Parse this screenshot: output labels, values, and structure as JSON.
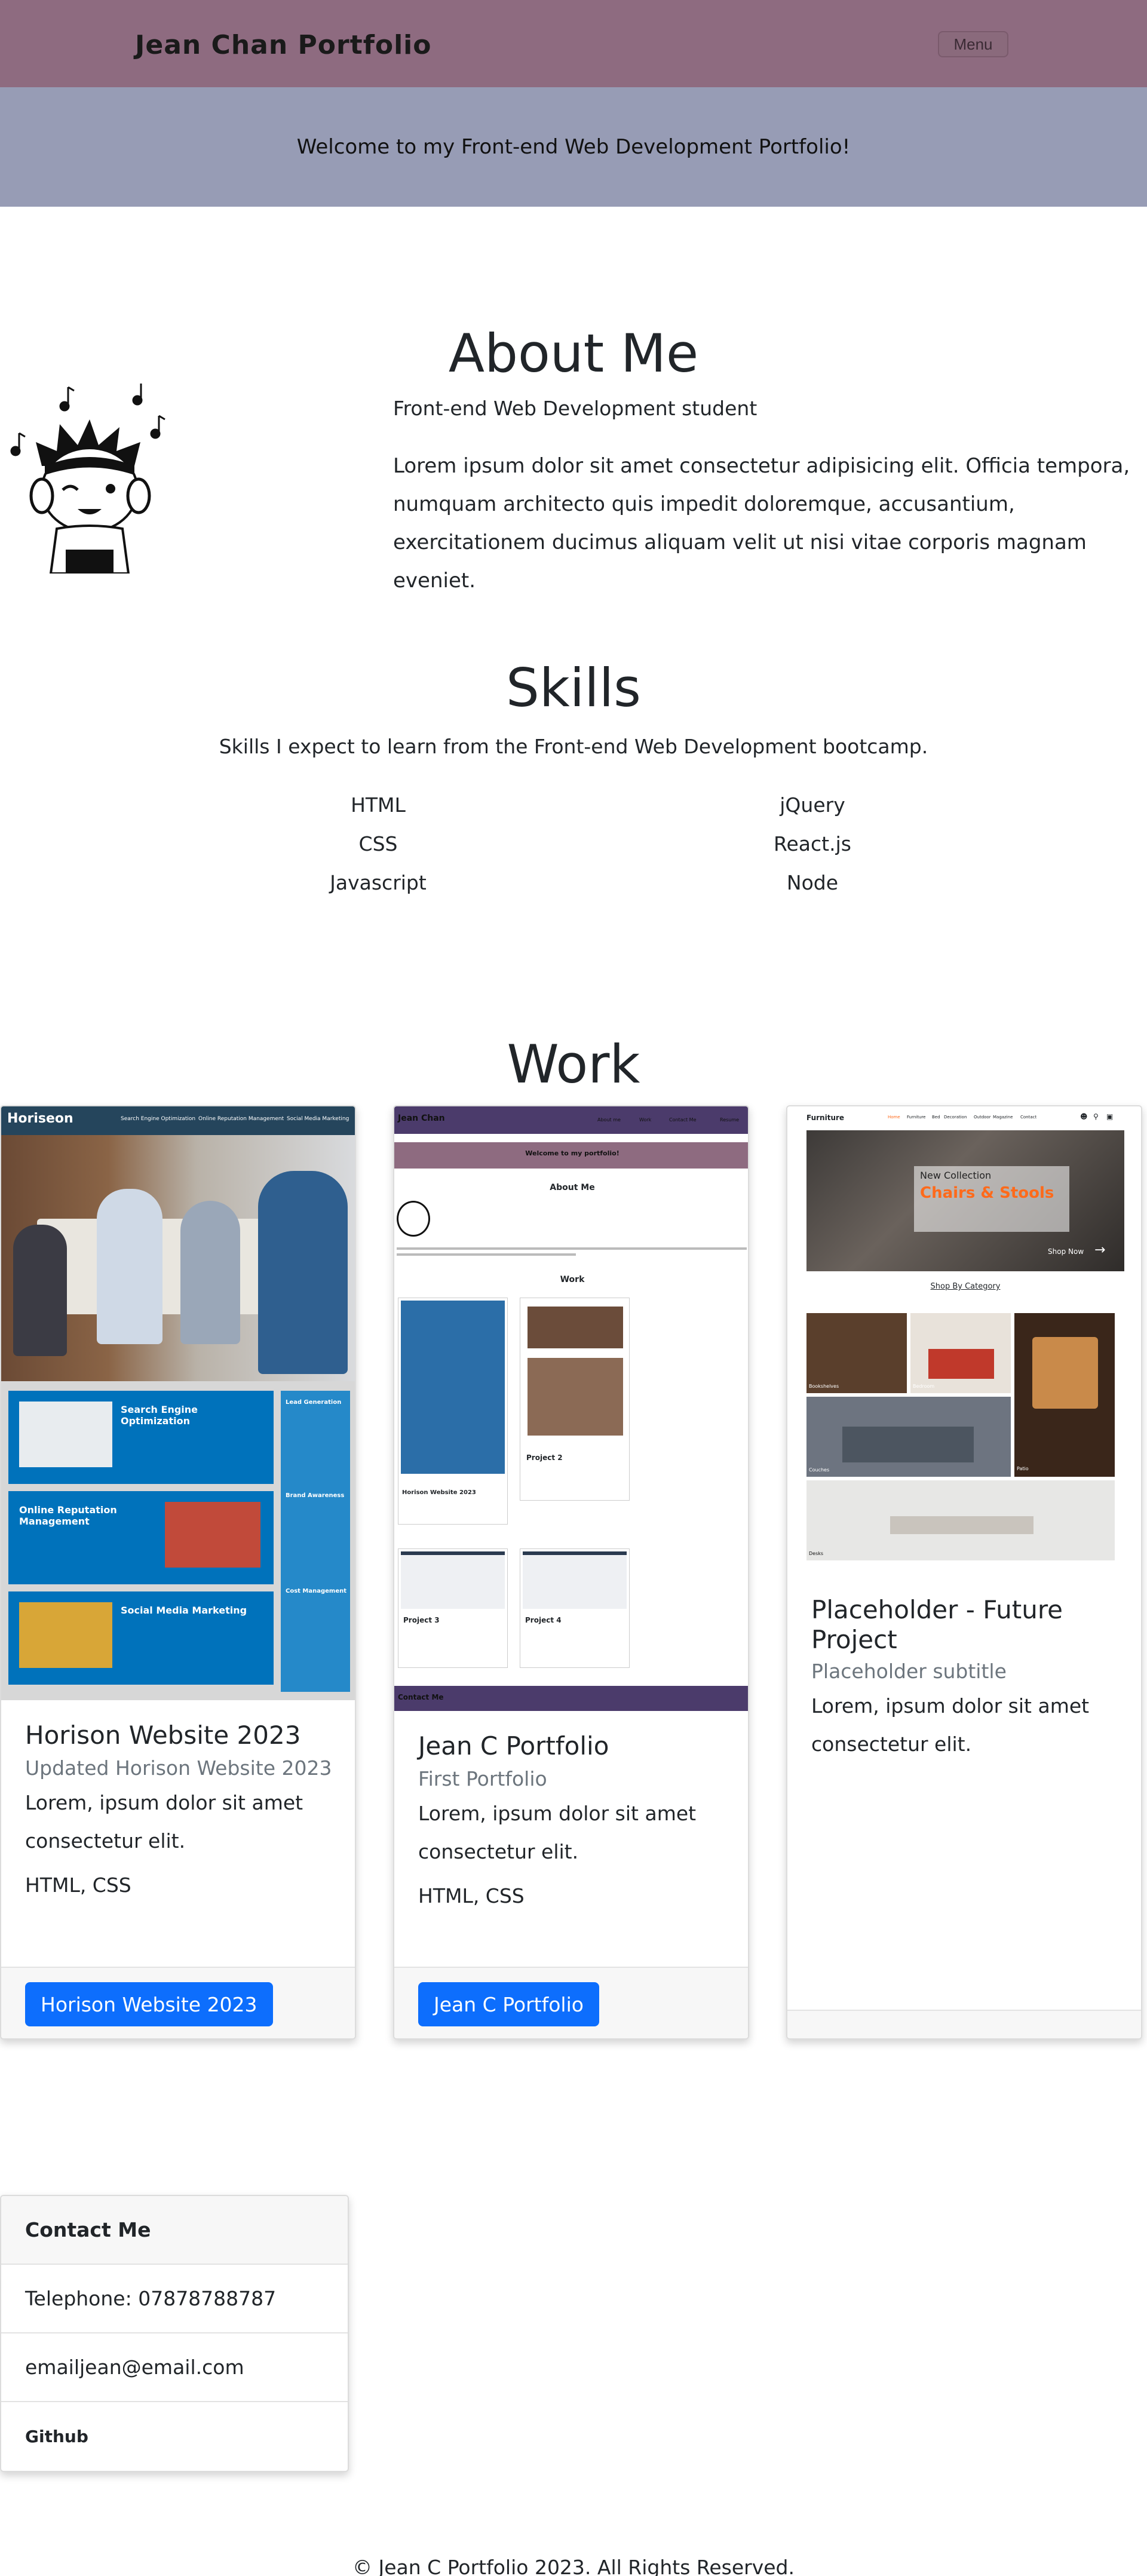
{
  "nav": {
    "brand": "Jean Chan Portfolio",
    "menu_label": "Menu"
  },
  "hero": {
    "text": "Welcome to my Front-end Web Development Portfolio!"
  },
  "about": {
    "title": "About Me",
    "subtitle": "Front-end Web Development student",
    "body": "Lorem ipsum dolor sit amet consectetur adipisicing elit. Officia tempora, numquam architecto quis impedit doloremque, accusantium, exercitationem ducimus aliquam velit ut nisi vitae corporis magnam eveniet."
  },
  "skills": {
    "title": "Skills",
    "intro": "Skills I expect to learn from the Front-end Web Development bootcamp.",
    "left": [
      "HTML",
      "CSS",
      "Javascript"
    ],
    "right": [
      "jQuery",
      "React.js",
      "Node"
    ]
  },
  "work": {
    "title": "Work",
    "cards": [
      {
        "title": "Horison Website 2023",
        "subtitle": "Updated Horison Website 2023",
        "text": "Lorem, ipsum dolor sit amet consectetur elit.",
        "tech": "HTML, CSS",
        "button": "Horison Website 2023",
        "preview": {
          "logo": "Horiseon",
          "nav": [
            "Search Engine Optimization",
            "Online Reputation Management",
            "Social Media Marketing"
          ],
          "blocks": [
            "Search Engine Optimization",
            "Online Reputation Management",
            "Social Media Marketing"
          ],
          "side": [
            "Lead Generation",
            "Brand Awareness",
            "Cost Management"
          ]
        }
      },
      {
        "title": "Jean C Portfolio",
        "subtitle": "First Portfolio",
        "text": "Lorem, ipsum dolor sit amet consectetur elit.",
        "tech": "HTML, CSS",
        "button": "Jean C Portfolio",
        "preview": {
          "brand": "Jean Chan",
          "nav": [
            "About me",
            "Work",
            "Contact Me",
            "Resume"
          ],
          "welcome": "Welcome to my portfolio!",
          "about": "About Me",
          "work": "Work",
          "projects": [
            "Horison Website 2023",
            "Project 2",
            "Project 3",
            "Project 4"
          ],
          "footer": "Contact Me"
        }
      },
      {
        "title": "Placeholder - Future Project",
        "subtitle": "Placeholder subtitle",
        "text": "Lorem, ipsum dolor sit amet consectetur elit.",
        "preview": {
          "brand": "Furniture",
          "nav": [
            "Home",
            "Furniture",
            "Bed",
            "Decoration",
            "Outdoor",
            "Magazine",
            "Contact"
          ],
          "collection": "New Collection",
          "headline": "Chairs & Stools",
          "shop": "Shop Now",
          "category_heading": "Shop By Category",
          "categories": [
            "Bookshelves",
            "Bedroom",
            "Patio",
            "Couches",
            "Desks"
          ]
        }
      }
    ]
  },
  "contact": {
    "title": "Contact Me",
    "telephone": "Telephone: 07878788787",
    "email": "emailjean@email.com",
    "github": "Github"
  },
  "footer": {
    "text": "© Jean C Portfolio 2023. All Rights Reserved."
  },
  "colors": {
    "nav": "#8e6b80",
    "hero": "#979cb5",
    "button": "#0d6efd",
    "horiseon_blue": "#0072bb",
    "furniture_orange": "#ff6a1a"
  }
}
